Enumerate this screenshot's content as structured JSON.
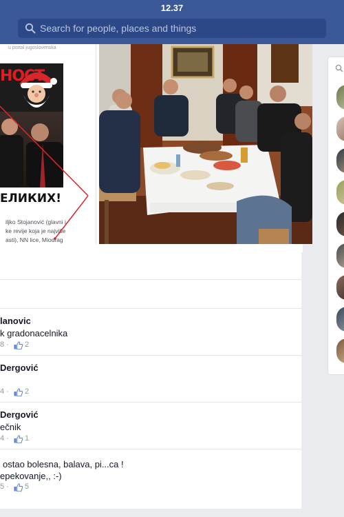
{
  "status": {
    "time": "12.37"
  },
  "search": {
    "placeholder": "Search for people, places and things",
    "icon": "search-icon"
  },
  "poster": {
    "caption_top": "u portal jugoslovenska",
    "title": "НОСТ",
    "banner": "ЕЛИКИХ!",
    "body_lines": [
      "iljko Stojanović (glavni i",
      "ke revije koja je najviše",
      "asti), NN lice, Miodrag"
    ]
  },
  "comments": [
    {
      "name": "lanovic",
      "text": "k gradonacelnika",
      "meta": "8 ·",
      "likes": "2"
    },
    {
      "name": "Dergović",
      "text": "",
      "meta": "4 ·",
      "likes": "2"
    },
    {
      "name": "Dergović",
      "text": "ečnik",
      "meta": "4 ·",
      "likes": "1"
    },
    {
      "name": "",
      "text": "ostao bolesna, balava, pi...ca !",
      "text2": "epekovanje,, :-)",
      "meta": "5 ·",
      "likes": "5"
    }
  ],
  "colors": {
    "brand": "#3b5998",
    "search_bg": "#2d4886",
    "meta": "#9197a3",
    "like": "#5b7bd5"
  }
}
